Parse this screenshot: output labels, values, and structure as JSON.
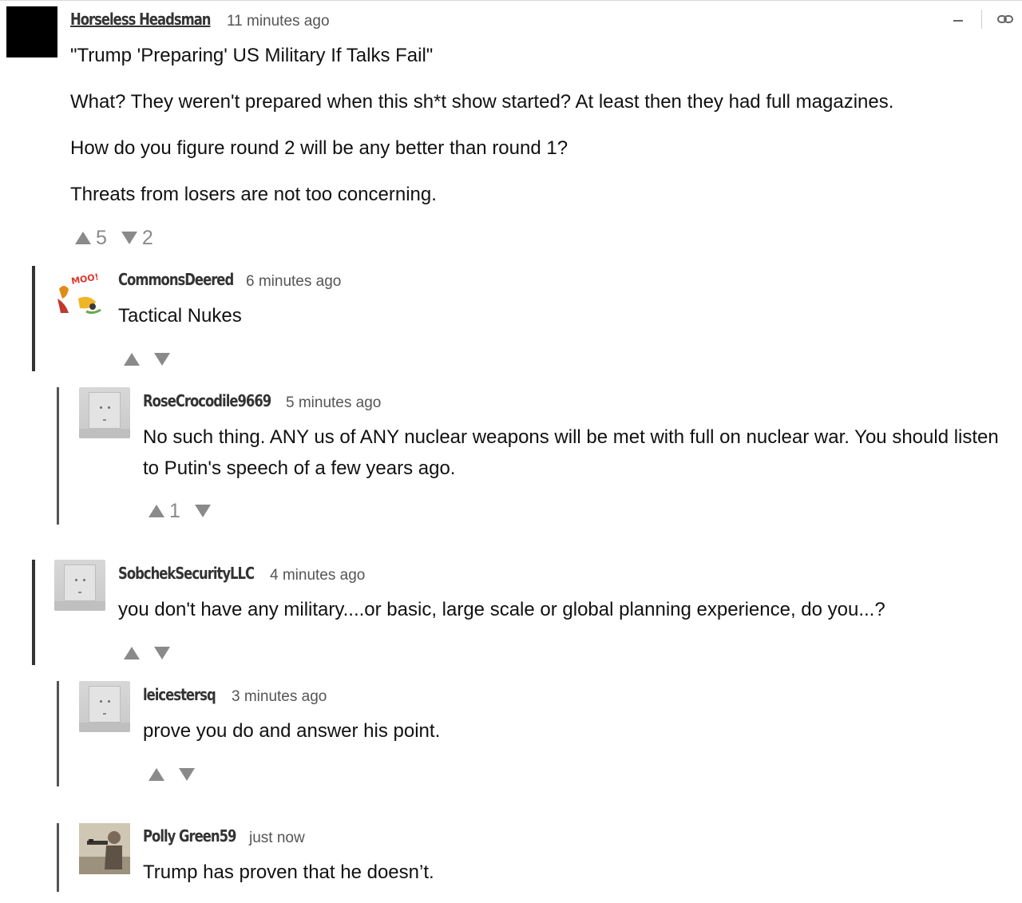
{
  "comments": [
    {
      "username": "Horseless Headsman",
      "timestamp": "11 minutes ago",
      "paragraphs": [
        "\"Trump 'Preparing' US Military If Talks Fail\"",
        "What? They weren't prepared when this sh*t show started? At least then they had full magazines.",
        "How do you figure round 2 will be any better than round 1?",
        "Threats from losers are not too concerning."
      ],
      "upvotes": "5",
      "downvotes": "2"
    },
    {
      "username": "CommonsDeered",
      "timestamp": "6 minutes ago",
      "paragraphs": [
        "Tactical Nukes"
      ],
      "avatar_text": "MOO!"
    },
    {
      "username": "RoseCrocodile9669",
      "timestamp": "5 minutes ago",
      "paragraphs": [
        "No such thing. ANY us of ANY nuclear weapons will be met with full on nuclear war. You should listen to Putin's speech of a few years ago."
      ],
      "upvotes": "1"
    },
    {
      "username": "SobchekSecurityLLC",
      "timestamp": "4 minutes ago",
      "paragraphs": [
        "you don't have any military....or basic, large scale or global planning experience, do you...?"
      ]
    },
    {
      "username": "leicestersq",
      "timestamp": "3 minutes ago",
      "paragraphs": [
        "prove you do and answer his point."
      ]
    },
    {
      "username": "Polly Green59",
      "timestamp": "just now",
      "paragraphs": [
        "Trump has proven that he doesn’t."
      ]
    }
  ],
  "icons": {
    "collapse": "minus-icon",
    "permalink": "link-icon",
    "upvote": "triangle-up-icon",
    "downvote": "triangle-down-icon"
  },
  "colors": {
    "thread_bar": "#333333",
    "vote_gray": "#8a8a8a",
    "text": "#111111"
  }
}
